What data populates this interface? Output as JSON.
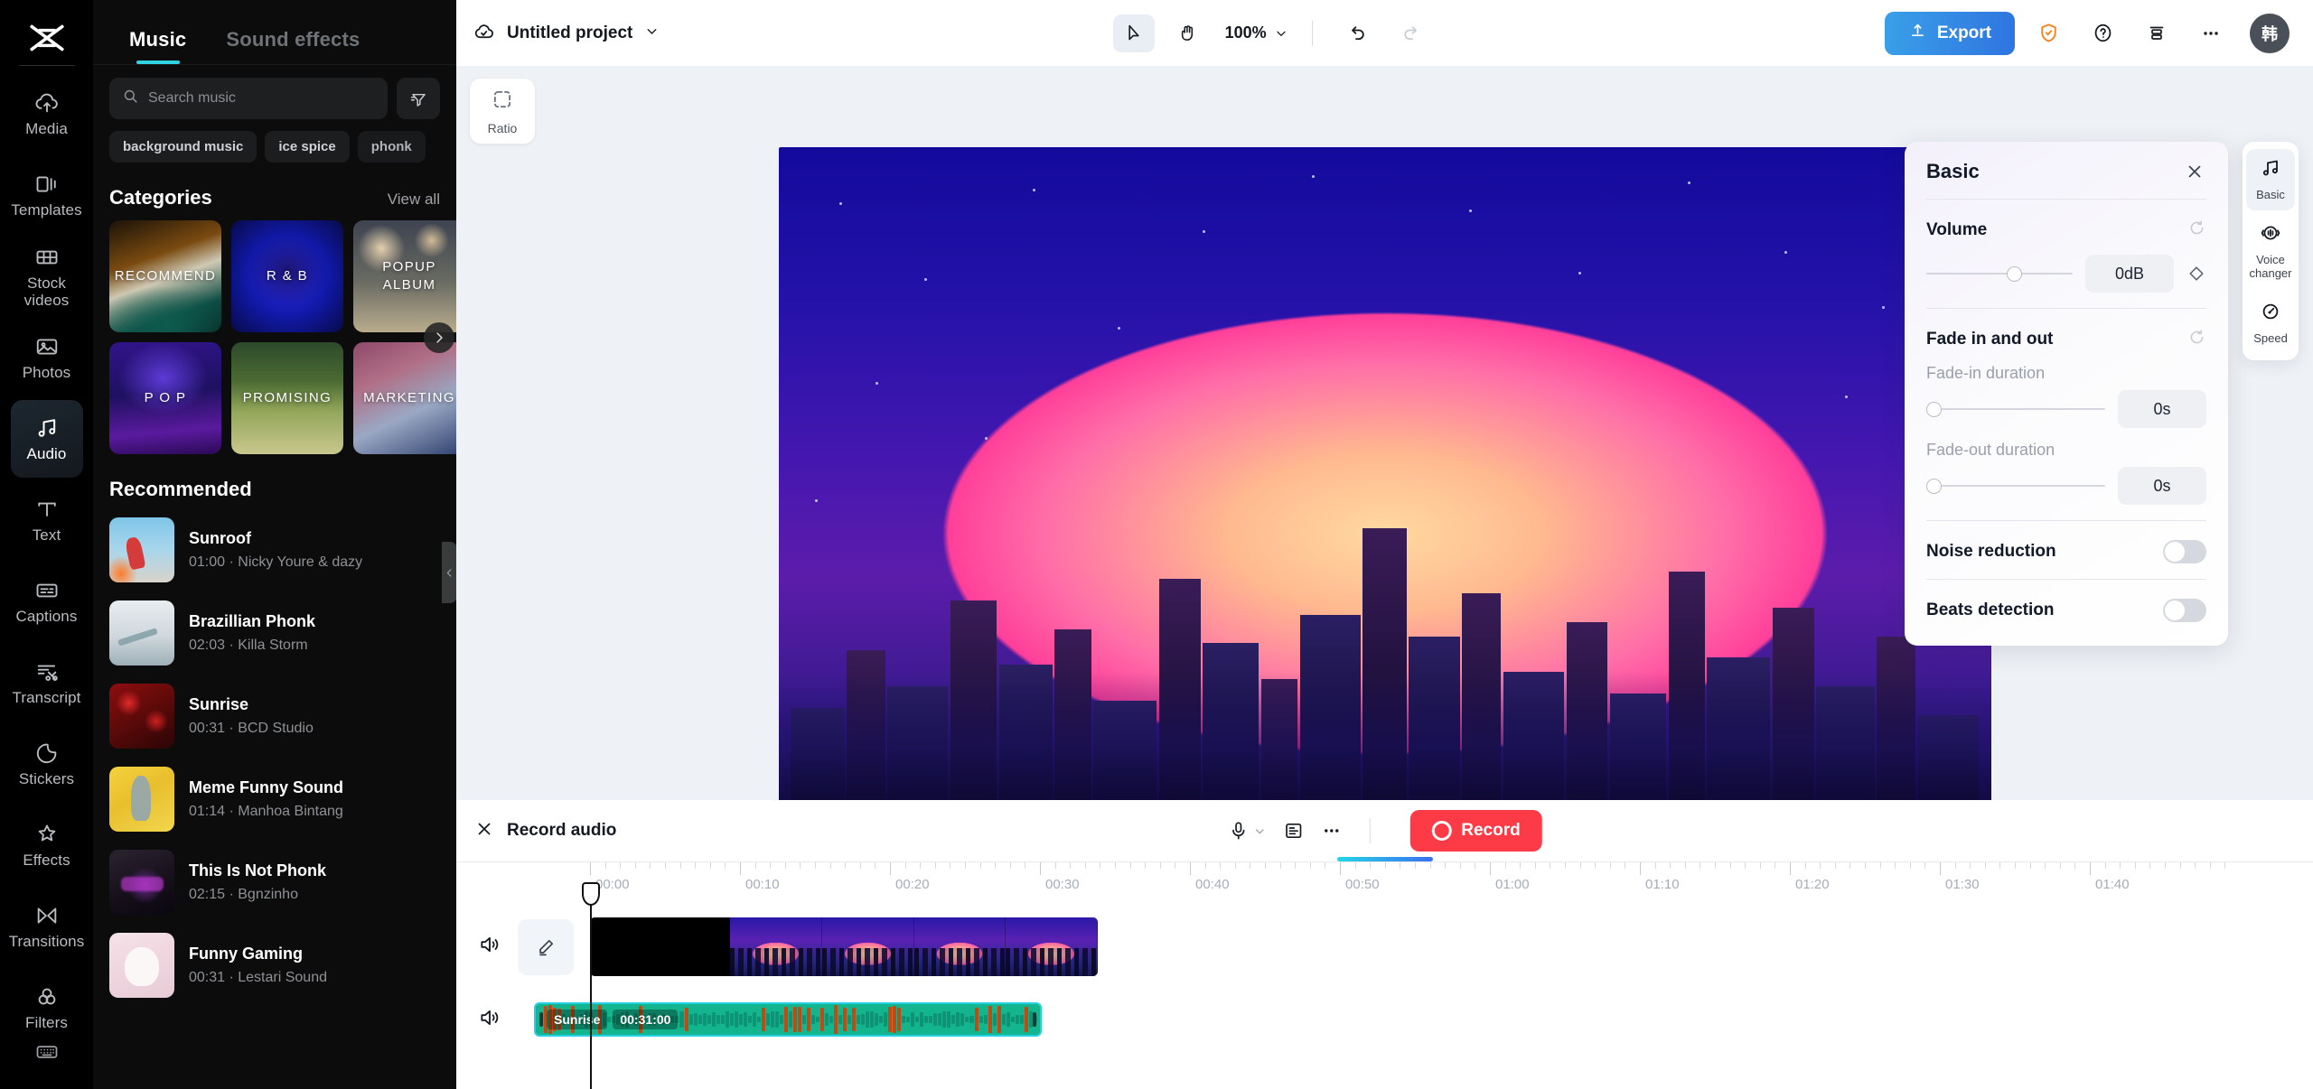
{
  "rail": {
    "logo_icon": "capcut-logo-icon",
    "items": [
      {
        "id": "media",
        "label": "Media",
        "icon": "cloud-upload-icon"
      },
      {
        "id": "templates",
        "label": "Templates",
        "icon": "templates-icon"
      },
      {
        "id": "stock-videos",
        "label": "Stock\nvideos",
        "icon": "film-strip-icon"
      },
      {
        "id": "photos",
        "label": "Photos",
        "icon": "image-icon"
      },
      {
        "id": "audio",
        "label": "Audio",
        "icon": "music-note-icon",
        "active": true
      },
      {
        "id": "text",
        "label": "Text",
        "icon": "text-t-icon"
      },
      {
        "id": "captions",
        "label": "Captions",
        "icon": "captions-icon"
      },
      {
        "id": "transcript",
        "label": "Transcript",
        "icon": "transcript-scissors-icon"
      },
      {
        "id": "stickers",
        "label": "Stickers",
        "icon": "sticker-icon"
      },
      {
        "id": "effects",
        "label": "Effects",
        "icon": "sparkle-star-icon"
      },
      {
        "id": "transitions",
        "label": "Transitions",
        "icon": "transitions-icon"
      },
      {
        "id": "filters",
        "label": "Filters",
        "icon": "filters-circles-icon"
      }
    ],
    "bottom_icon": "keyboard-icon"
  },
  "panel": {
    "tabs": [
      {
        "id": "music",
        "label": "Music",
        "active": true
      },
      {
        "id": "sound-effects",
        "label": "Sound effects",
        "active": false
      }
    ],
    "search": {
      "value": "",
      "placeholder": "Search music",
      "icon": "search-icon"
    },
    "filter_icon": "filter-icon",
    "tags": [
      "background music",
      "ice spice",
      "phonk"
    ],
    "categories_header": {
      "title": "Categories",
      "link": "View all"
    },
    "categories": [
      {
        "label": "RECOMMEND",
        "theme": "c-recommend"
      },
      {
        "label": "R & B",
        "theme": "c-rnb"
      },
      {
        "label": "POPUP ALBUM",
        "theme": "c-popup"
      },
      {
        "label": "P O P",
        "theme": "c-pop"
      },
      {
        "label": "PROMISING",
        "theme": "c-promising"
      },
      {
        "label": "MARKETING",
        "theme": "c-marketing"
      }
    ],
    "categories_next_icon": "chevron-right-icon",
    "recommended_header": "Recommended",
    "recommended": [
      {
        "name": "Sunroof",
        "meta": "01:00 · Nicky Youre & dazy",
        "theme": "t-sunroof"
      },
      {
        "name": "Brazillian Phonk",
        "meta": "02:03 · Killa Storm",
        "theme": "t-phonk"
      },
      {
        "name": "Sunrise",
        "meta": "00:31 · BCD Studio",
        "theme": "t-sunrise"
      },
      {
        "name": "Meme Funny Sound",
        "meta": "01:14 · Manhoa Bintang",
        "theme": "t-meme"
      },
      {
        "name": "This Is Not Phonk",
        "meta": "02:15 · Bgnzinho",
        "theme": "t-notphonk"
      },
      {
        "name": "Funny Gaming",
        "meta": "00:31 · Lestari Sound",
        "theme": "t-cat"
      }
    ],
    "collapse_icon": "chevron-left-icon"
  },
  "topbar": {
    "cloud_icon": "cloud-check-icon",
    "project_name": "Untitled project",
    "project_caret_icon": "chevron-down-icon",
    "select_tool_icon": "cursor-arrow-icon",
    "hand_tool_icon": "hand-icon",
    "zoom_level": "100%",
    "zoom_caret_icon": "chevron-down-icon",
    "undo_icon": "undo-icon",
    "redo_icon": "redo-icon",
    "export_label": "Export",
    "export_icon": "upload-icon",
    "shield_icon": "shield-check-icon",
    "help_icon": "question-circle-icon",
    "layers_icon": "layers-icon",
    "more_icon": "ellipsis-icon",
    "avatar_label": "韩",
    "export_color": "#2f74e0",
    "shield_color": "#f5821f"
  },
  "stage": {
    "ratio_label": "Ratio",
    "ratio_icon": "crop-dashed-icon"
  },
  "props": {
    "title": "Basic",
    "close_icon": "close-icon",
    "reset_icon": "reset-icon",
    "volume": {
      "label": "Volume",
      "value": "0dB",
      "slider_pct": 55,
      "keyframe_icon": "diamond-keyframe-icon"
    },
    "fade": {
      "label": "Fade in and out",
      "fade_in_label": "Fade-in duration",
      "fade_in_value": "0s",
      "fade_in_pct": 0,
      "fade_out_label": "Fade-out duration",
      "fade_out_value": "0s",
      "fade_out_pct": 0
    },
    "noise_reduction": {
      "label": "Noise reduction",
      "on": false
    },
    "beats_detection": {
      "label": "Beats detection",
      "on": false
    }
  },
  "minitabs": [
    {
      "id": "basic",
      "label": "Basic",
      "icon": "music-note-icon",
      "active": true
    },
    {
      "id": "voice-changer",
      "label": "Voice\nchanger",
      "icon": "voice-changer-icon",
      "active": false
    },
    {
      "id": "speed",
      "label": "Speed",
      "icon": "speedometer-icon",
      "active": false
    }
  ],
  "timeline": {
    "close_icon": "close-icon",
    "record_audio_label": "Record audio",
    "mic_icon": "microphone-icon",
    "mic_caret_icon": "chevron-down-icon",
    "subtitle_icon": "subtitle-icon",
    "more_icon": "ellipsis-icon",
    "record_label": "Record",
    "record_icon": "record-circle-icon",
    "record_color": "#fc3b46",
    "ruler_labels": [
      "00:00",
      "00:10",
      "00:20",
      "00:30",
      "00:40",
      "00:50",
      "01:00",
      "01:10",
      "01:20",
      "01:30",
      "01:40"
    ],
    "tracks": [
      {
        "id": "video-track",
        "mute_icon": "speaker-on-icon",
        "edit_icon": "pencil-edit-icon",
        "clip_type": "video"
      },
      {
        "id": "audio-track",
        "mute_icon": "speaker-on-icon",
        "clip_type": "audio",
        "clip_name": "Sunrise",
        "clip_duration": "00:31:00"
      }
    ],
    "playhead_time": "00:00"
  }
}
